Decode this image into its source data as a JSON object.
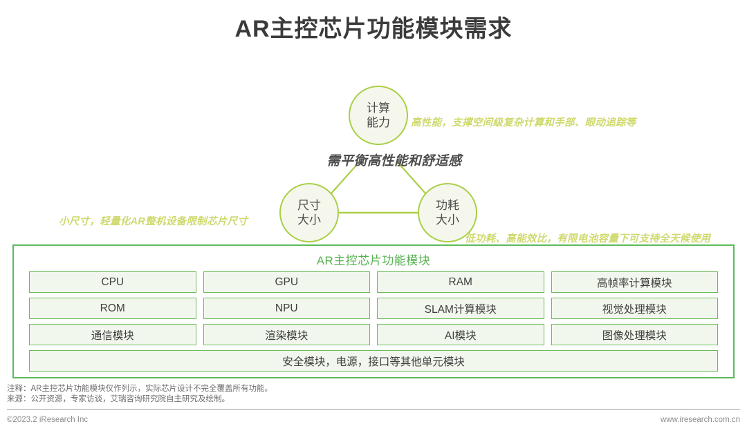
{
  "page": {
    "title": "AR主控芯片功能模块需求"
  },
  "diagram": {
    "center_label": "需平衡高性能和舒适感",
    "nodes": [
      {
        "id": "compute",
        "line1": "计算",
        "line2": "能力"
      },
      {
        "id": "size",
        "line1": "尺寸",
        "line2": "大小"
      },
      {
        "id": "power",
        "line1": "功耗",
        "line2": "大小"
      }
    ],
    "annotations": [
      {
        "id": "compute-note",
        "text": "高性能，支撑空间级复杂计算和手部、眼动追踪等"
      },
      {
        "id": "size-note",
        "text": "小尺寸，轻量化AR整机设备限制芯片尺寸"
      },
      {
        "id": "power-note",
        "text": "低功耗、高能效比，有限电池容量下可支持全天候使用"
      }
    ],
    "colors": {
      "node_border": "#a9cf46",
      "node_fill": "#f5f7ec",
      "edge": "#a9cf46",
      "annotation_text": "#cfd96d",
      "center_text": "#4c4c4c"
    }
  },
  "modules": {
    "header": "AR主控芯片功能模块",
    "grid": [
      "CPU",
      "GPU",
      "RAM",
      "高帧率计算模块",
      "ROM",
      "NPU",
      "SLAM计算模块",
      "视觉处理模块",
      "通信模块",
      "渲染模块",
      "AI模块",
      "图像处理模块"
    ],
    "wide_row": "安全模块，电源，接口等其他单元模块",
    "colors": {
      "container_border": "#5cb85c",
      "cell_border": "#6cbb5a",
      "cell_fill": "#f1f7ec",
      "header_text": "#56b24f"
    }
  },
  "footnotes": {
    "note": "注释：AR主控芯片功能模块仅作列示，实际芯片设计不完全覆盖所有功能。",
    "source": "来源：公开资源，专家访谈，艾瑞咨询研究院自主研究及绘制。"
  },
  "footer": {
    "copyright": "©2023.2 iResearch Inc",
    "website": "www.iresearch.com.cn"
  }
}
